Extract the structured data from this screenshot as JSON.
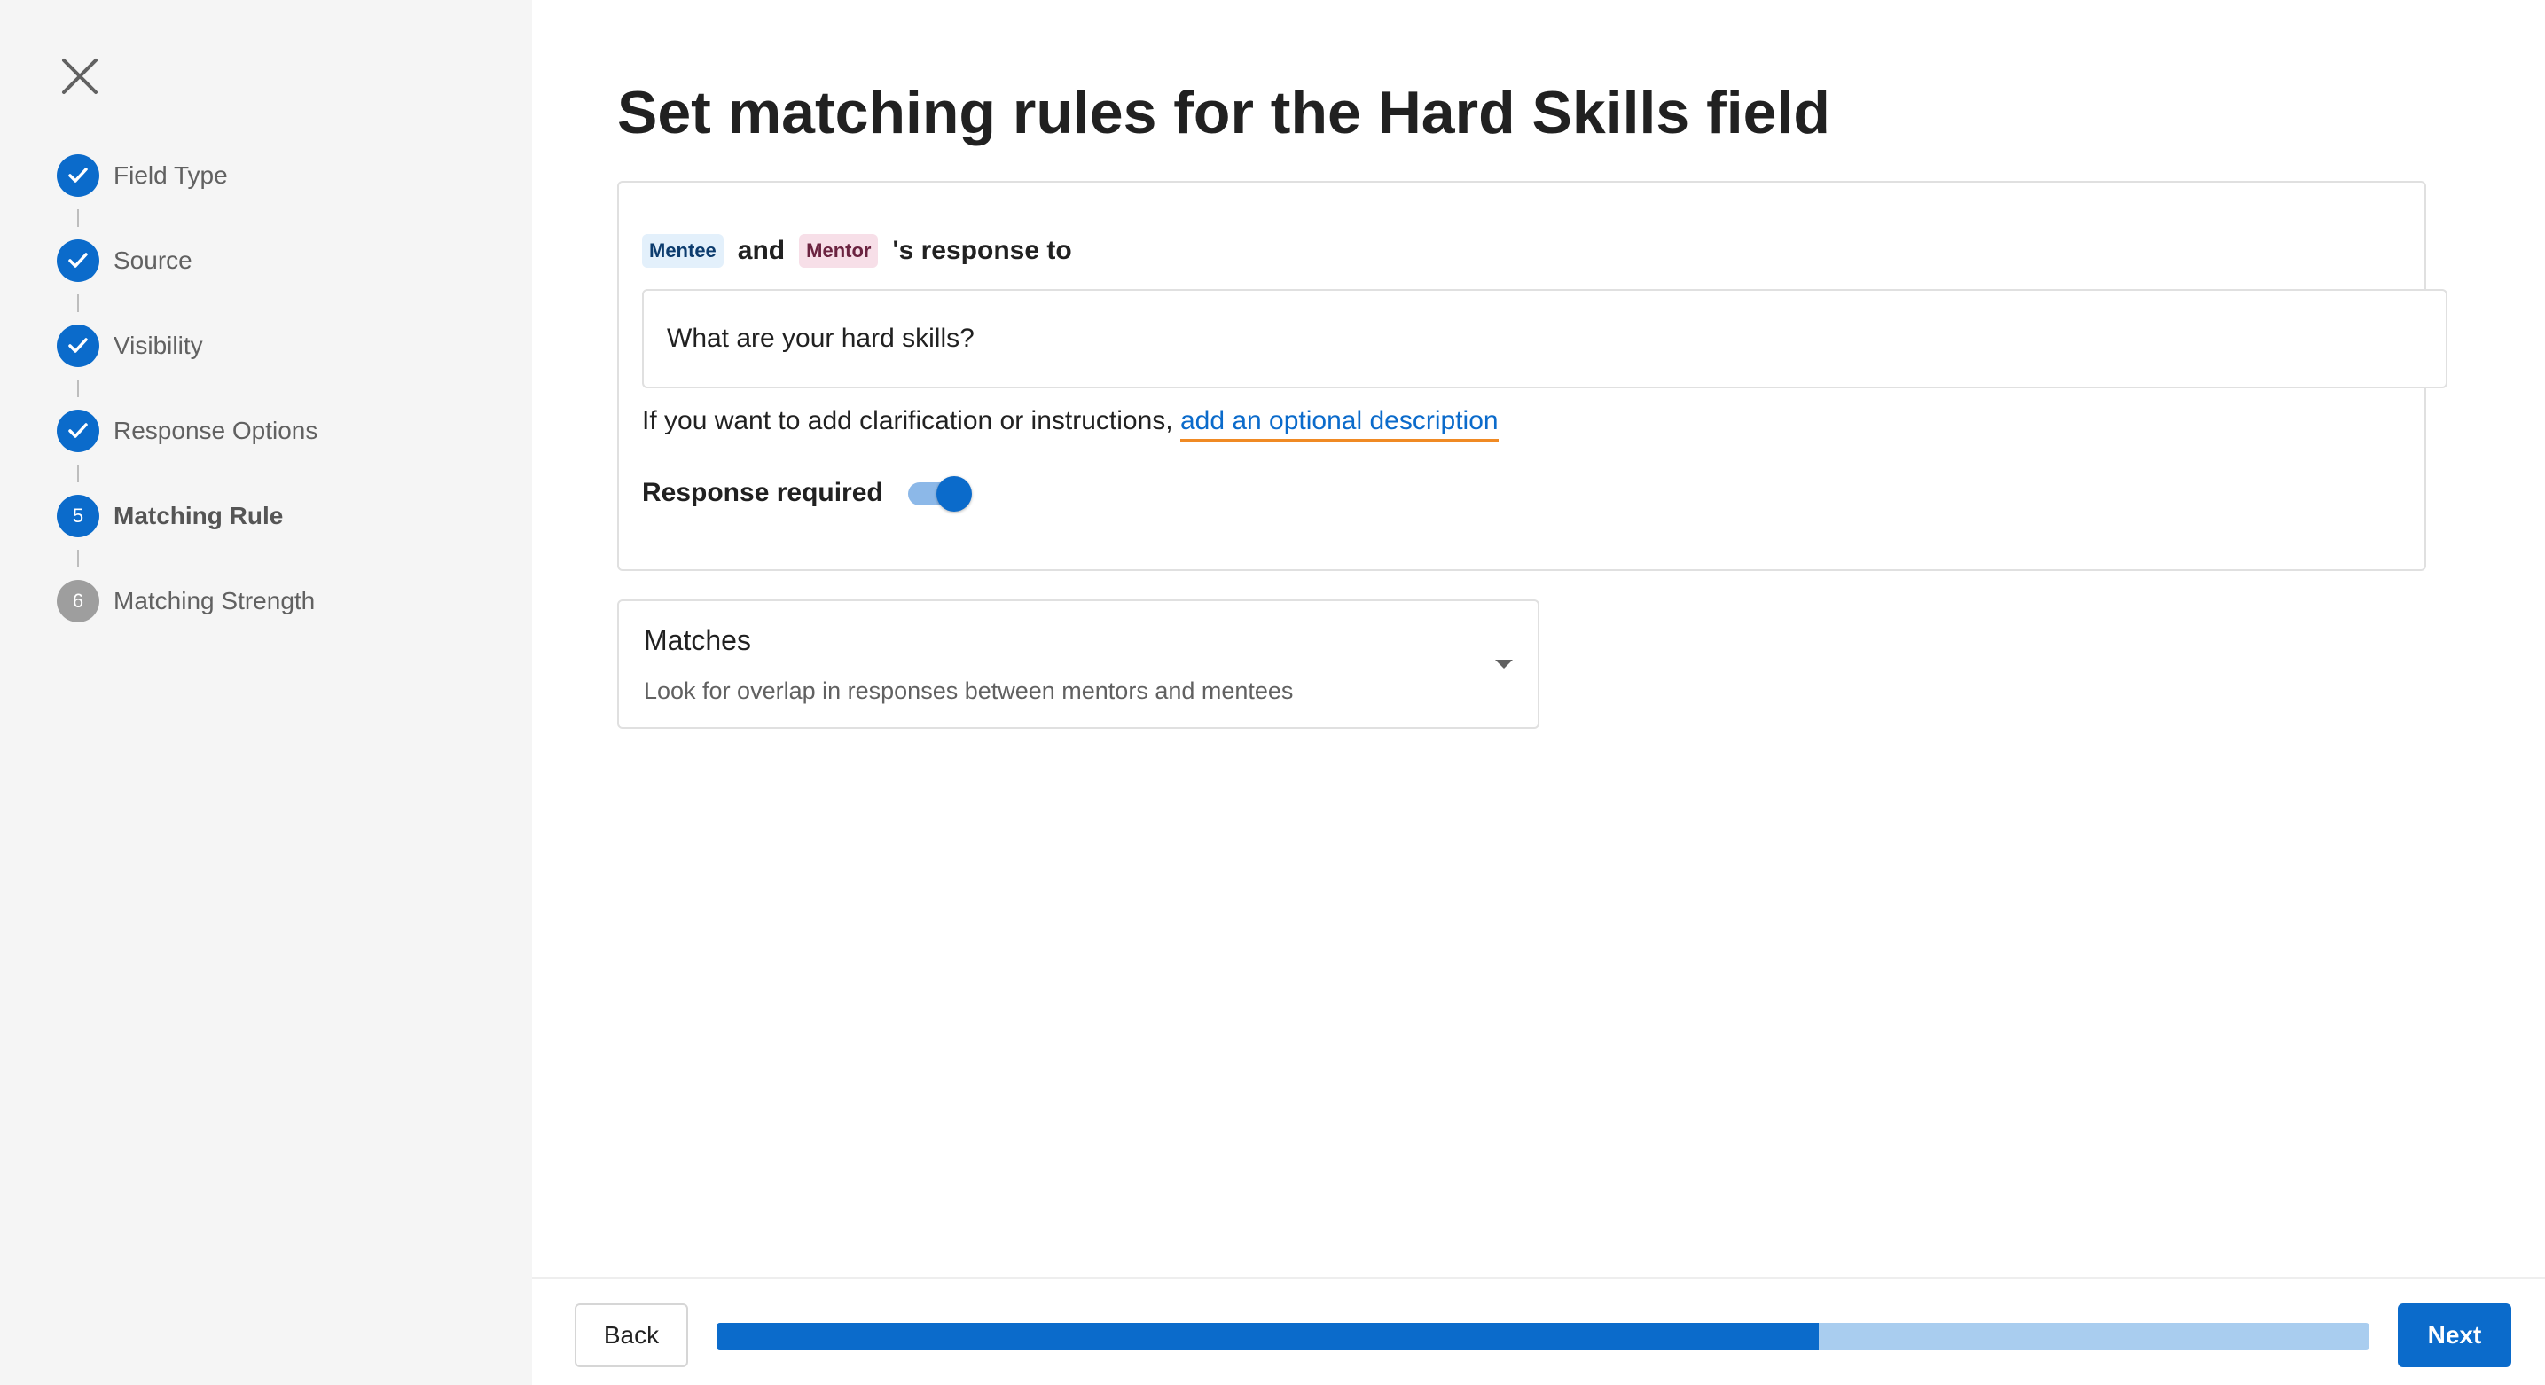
{
  "sidebar": {
    "close_icon": "close-icon",
    "steps": [
      {
        "label": "Field Type",
        "status": "done",
        "marker": ""
      },
      {
        "label": "Source",
        "status": "done",
        "marker": ""
      },
      {
        "label": "Visibility",
        "status": "done",
        "marker": ""
      },
      {
        "label": "Response Options",
        "status": "done",
        "marker": ""
      },
      {
        "label": "Matching Rule",
        "status": "active",
        "marker": "5"
      },
      {
        "label": "Matching Strength",
        "status": "pending",
        "marker": "6"
      }
    ]
  },
  "main": {
    "title": "Set matching rules for the Hard Skills field",
    "response": {
      "chip_mentee": "Mentee",
      "and_text": "and",
      "chip_mentor": "Mentor",
      "suffix_text": "'s response to"
    },
    "question_value": "What are your hard skills?",
    "description_prefix": "If you want to add clarification or instructions, ",
    "description_link": "add an optional description",
    "response_required_label": "Response required",
    "response_required": true,
    "select": {
      "title": "Matches",
      "subtitle": "Look for overlap in responses between mentors and mentees"
    }
  },
  "footer": {
    "back_label": "Back",
    "next_label": "Next",
    "progress": 0.667
  },
  "colors": {
    "accent": "#0b6bcb",
    "progress_track": "#a9cdef",
    "link_underline": "#f08a24",
    "mentee_chip_bg": "#e3f0fb",
    "mentor_chip_bg": "#f7dfe8"
  }
}
